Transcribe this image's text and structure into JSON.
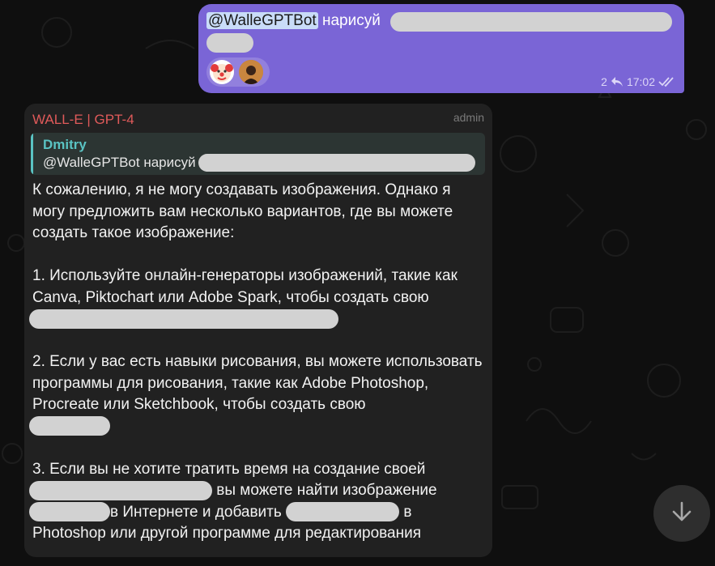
{
  "outgoing": {
    "mention": "@WalleGPTBot",
    "text": " нарисуй",
    "reply_count": "2",
    "time": "17:02"
  },
  "incoming": {
    "sender": "WALL-E | GPT-4",
    "role": "admin",
    "reply_to": {
      "name": "Dmitry",
      "text": "@WalleGPTBot нарисуй"
    },
    "paragraphs": {
      "p0": "К сожалению, я не могу создавать изображения. Однако я могу предложить вам несколько вариантов, где вы можете создать такое изображение:",
      "p1": "1. Используйте онлайн-генераторы изображений, такие как Canva, Piktochart или Adobe Spark, чтобы создать свою",
      "p2": "2. Если у вас есть навыки рисования, вы можете использовать программы для рисования, такие как Adobe Photoshop, Procreate или Sketchbook, чтобы создать свою",
      "p3a": "3. Если вы не хотите тратить время на создание своей",
      "p3b": " вы можете найти изображение",
      "p3c": "в Интернете и добавить",
      "p3d": " в Photoshop или другой программе для редактирования"
    }
  },
  "colors": {
    "outgoing_bubble": "#7a65d6",
    "incoming_bubble": "#212121",
    "sender_name": "#e05a5a",
    "reply_accent": "#5ac3c3"
  },
  "icons": {
    "reply": "reply-arrow-icon",
    "read": "double-check-icon",
    "scroll": "arrow-down-icon"
  }
}
